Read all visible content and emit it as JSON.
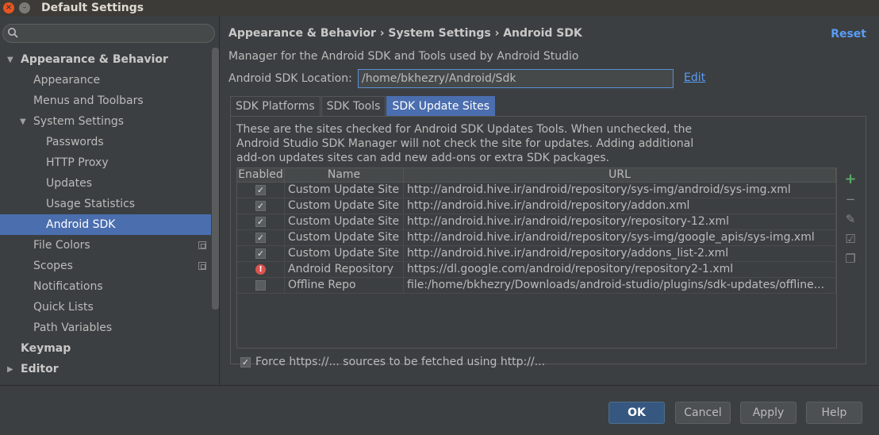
{
  "window": {
    "title": "Default Settings",
    "close_glyph": "×",
    "min_glyph": "–"
  },
  "sidebar": {
    "search_placeholder": "",
    "items": [
      {
        "label": "Appearance & Behavior",
        "level": 0,
        "bold": true,
        "expanded": true
      },
      {
        "label": "Appearance",
        "level": 1
      },
      {
        "label": "Menus and Toolbars",
        "level": 1
      },
      {
        "label": "System Settings",
        "level": 1,
        "expanded": true
      },
      {
        "label": "Passwords",
        "level": 2
      },
      {
        "label": "HTTP Proxy",
        "level": 2
      },
      {
        "label": "Updates",
        "level": 2
      },
      {
        "label": "Usage Statistics",
        "level": 2
      },
      {
        "label": "Android SDK",
        "level": 2,
        "selected": true
      },
      {
        "label": "File Colors",
        "level": 1,
        "project_icon": true
      },
      {
        "label": "Scopes",
        "level": 1,
        "project_icon": true
      },
      {
        "label": "Notifications",
        "level": 1
      },
      {
        "label": "Quick Lists",
        "level": 1
      },
      {
        "label": "Path Variables",
        "level": 1
      },
      {
        "label": "Keymap",
        "level": 0,
        "bold": true
      },
      {
        "label": "Editor",
        "level": 0,
        "bold": true,
        "collapsed": true
      }
    ]
  },
  "main": {
    "breadcrumb": "Appearance & Behavior › System Settings › Android SDK",
    "reset_label": "Reset",
    "description": "Manager for the Android SDK and Tools used by Android Studio",
    "sdk_location_label": "Android SDK Location:",
    "sdk_location_value": "/home/bkhezry/Android/Sdk",
    "edit_label": "Edit",
    "tabs": [
      {
        "label": "SDK Platforms"
      },
      {
        "label": "SDK Tools"
      },
      {
        "label": "SDK Update Sites",
        "active": true
      }
    ],
    "panel_text": "These are the sites checked for Android SDK Updates Tools. When unchecked, the Android Studio SDK Manager will not check the site for updates. Adding additional add-on updates sites can add new add-ons or extra SDK packages.",
    "table": {
      "headers": [
        "Enabled",
        "Name",
        "URL"
      ],
      "rows": [
        {
          "state": "checked",
          "name": "Custom Update Site",
          "url": "http://android.hive.ir/android/repository/sys-img/android/sys-img.xml"
        },
        {
          "state": "checked",
          "name": "Custom Update Site",
          "url": "http://android.hive.ir/android/repository/addon.xml"
        },
        {
          "state": "checked",
          "name": "Custom Update Site",
          "url": "http://android.hive.ir/android/repository/repository-12.xml"
        },
        {
          "state": "checked",
          "name": "Custom Update Site",
          "url": "http://android.hive.ir/android/repository/sys-img/google_apis/sys-img.xml"
        },
        {
          "state": "checked",
          "name": "Custom Update Site",
          "url": "http://android.hive.ir/android/repository/addons_list-2.xml"
        },
        {
          "state": "error",
          "name": "Android Repository",
          "url": "https://dl.google.com/android/repository/repository2-1.xml"
        },
        {
          "state": "unchecked",
          "name": "Offline Repo",
          "url": "file:/home/bkhezry/Downloads/android-studio/plugins/sdk-updates/offline..."
        }
      ]
    },
    "tools": [
      {
        "name": "add-icon",
        "glyph": "+"
      },
      {
        "name": "remove-icon",
        "glyph": "−"
      },
      {
        "name": "edit-icon",
        "glyph": "✎"
      },
      {
        "name": "select-all-icon",
        "glyph": "☑"
      },
      {
        "name": "copy-icon",
        "glyph": "❐"
      }
    ],
    "force_https_label": "Force https://... sources to be fetched using http://...",
    "force_https_checked": true
  },
  "footer": {
    "ok_label": "OK",
    "cancel_label": "Cancel",
    "apply_label": "Apply",
    "help_label": "Help"
  },
  "colors": {
    "background": "#3c3f41",
    "selection": "#4b6eaf",
    "link": "#589df6",
    "ok_button": "#365880",
    "add_icon": "#59a869",
    "error_icon": "#d9534f"
  }
}
